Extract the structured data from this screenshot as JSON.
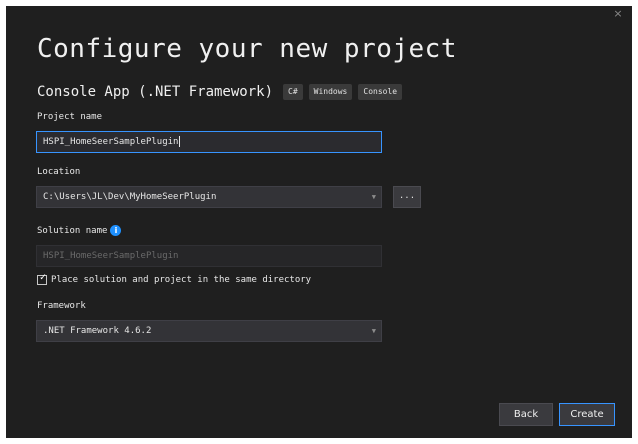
{
  "dialog": {
    "close_glyph": "×",
    "title": "Configure your new project",
    "subtitle": "Console App (.NET Framework)",
    "tags": [
      "C#",
      "Windows",
      "Console"
    ]
  },
  "form": {
    "project_name": {
      "label": "Project name",
      "value": "HSPI_HomeSeerSamplePlugin"
    },
    "location": {
      "label": "Location",
      "value": "C:\\Users\\JL\\Dev\\MyHomeSeerPlugin",
      "browse_label": "..."
    },
    "solution_name": {
      "label": "Solution name",
      "placeholder": "HSPI_HomeSeerSamplePlugin",
      "info_glyph": "i"
    },
    "same_directory": {
      "label": "Place solution and project in the same directory",
      "checked": true
    },
    "framework": {
      "label": "Framework",
      "value": ".NET Framework 4.6.2"
    }
  },
  "footer": {
    "back_label": "Back",
    "create_label": "Create"
  },
  "icons": {
    "dropdown_arrow": "chevron-down-icon",
    "checkmark": "check-icon",
    "info": "info-icon",
    "close": "close-icon"
  },
  "colors": {
    "background": "#1f1f1f",
    "accent": "#3794ff",
    "info": "#1e90ff"
  }
}
